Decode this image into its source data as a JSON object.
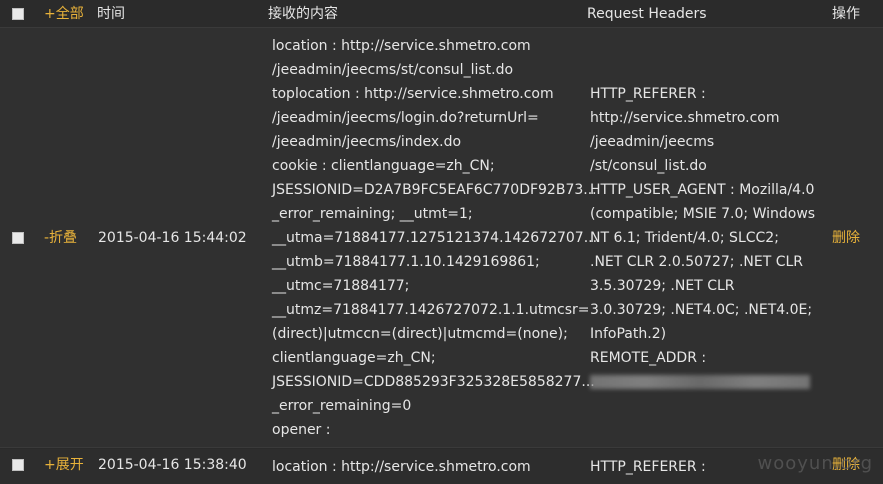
{
  "header": {
    "select_all": "+全部",
    "time": "时间",
    "content": "接收的内容",
    "request_headers": "Request Headers",
    "action": "操作"
  },
  "rows": [
    {
      "toggle": "-折叠",
      "time": "2015-04-16 15:44:02",
      "content_lines": [
        "location : http://service.shmetro.com",
        "/jeeadmin/jeecms/st/consul_list.do",
        "toplocation : http://service.shmetro.com",
        "/jeeadmin/jeecms/login.do?returnUrl=",
        "/jeeadmin/jeecms/index.do",
        "cookie : clientlanguage=zh_CN;",
        "JSESSIONID=D2A7B9FC5EAF6C770DF92B73...",
        "_error_remaining; __utmt=1;",
        "__utma=71884177.1275121374.142672707...",
        "__utmb=71884177.1.10.1429169861;",
        "__utmc=71884177;",
        "__utmz=71884177.1426727072.1.1.utmcsr=",
        "(direct)|utmccn=(direct)|utmcmd=(none);",
        "clientlanguage=zh_CN;",
        "JSESSIONID=CDD885293F325328E5858277...",
        "_error_remaining=0",
        "opener :"
      ],
      "header_lines": [
        "HTTP_REFERER :",
        "http://service.shmetro.com",
        "/jeeadmin/jeecms",
        "/st/consul_list.do",
        "HTTP_USER_AGENT : Mozilla/4.0",
        "(compatible; MSIE 7.0; Windows",
        "NT 6.1; Trident/4.0; SLCC2;",
        ".NET CLR 2.0.50727; .NET CLR",
        "3.5.30729; .NET CLR",
        "3.0.30729; .NET4.0C; .NET4.0E;",
        "InfoPath.2)",
        "REMOTE_ADDR :"
      ],
      "delete": "删除"
    },
    {
      "toggle": "+展开",
      "time": "2015-04-16 15:38:40",
      "content_first": "location : http://service.shmetro.com",
      "header_first": "HTTP_REFERER :",
      "delete": "删除"
    }
  ],
  "watermark": "wooyun.org",
  "colors": {
    "accent": "#e8b23a",
    "text": "#e6e6e6",
    "background": "#2a2a2a"
  }
}
